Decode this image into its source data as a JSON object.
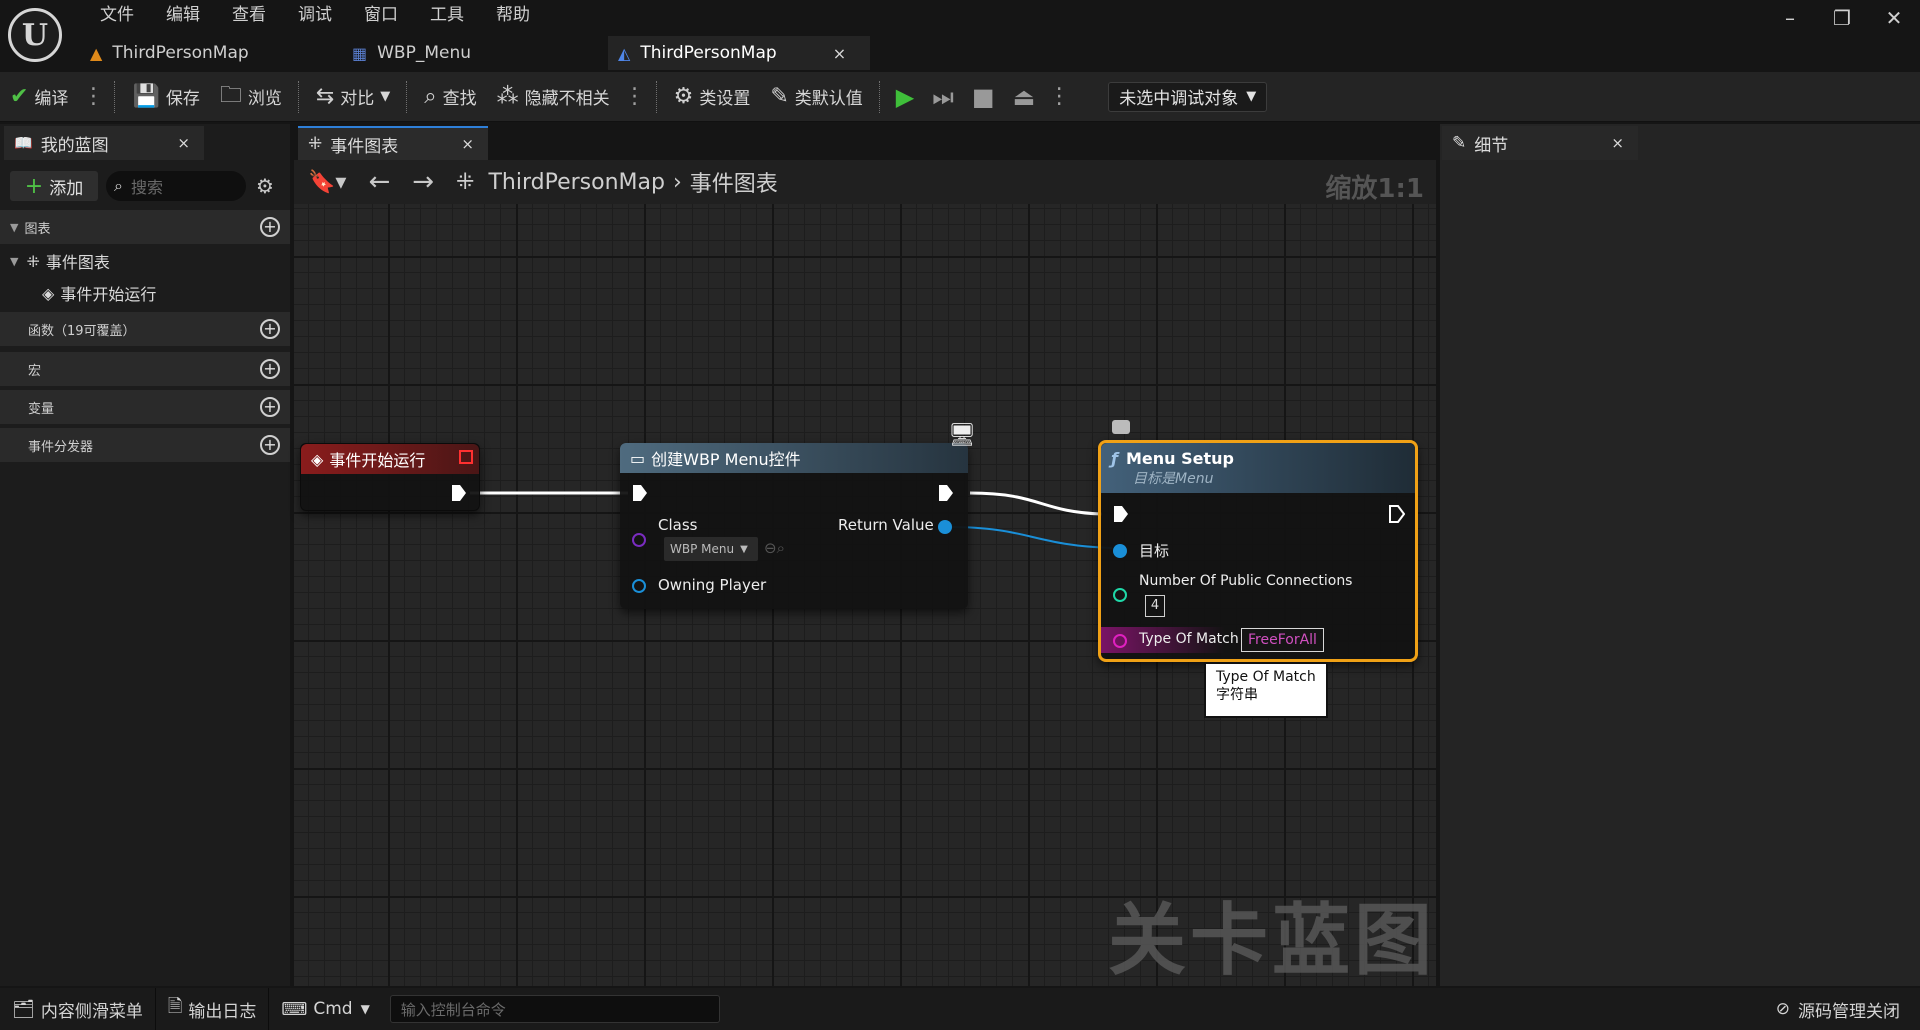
{
  "menu": [
    "文件",
    "编辑",
    "查看",
    "调试",
    "窗口",
    "工具",
    "帮助"
  ],
  "doc_tabs": [
    {
      "label": "ThirdPersonMap",
      "icon": "level-icon"
    },
    {
      "label": "WBP_Menu",
      "icon": "widget-blueprint-icon"
    },
    {
      "label": "ThirdPersonMap",
      "icon": "level-blueprint-icon",
      "active": true
    }
  ],
  "toolbar": {
    "compile": "编译",
    "save": "保存",
    "browse": "浏览",
    "diff": "对比",
    "find": "查找",
    "hide_unrelated": "隐藏不相关",
    "class_settings": "类设置",
    "class_defaults": "类默认值",
    "debug_object": "未选中调试对象"
  },
  "left_panel": {
    "tab_label": "我的蓝图",
    "add_label": "添加",
    "search_placeholder": "搜索",
    "sections": {
      "graphs": "图表",
      "event_graph": "事件图表",
      "begin_play": "事件开始运行",
      "functions": "函数（19可覆盖）",
      "macros": "宏",
      "variables": "变量",
      "dispatchers": "事件分发器"
    }
  },
  "graph": {
    "tab_label": "事件图表",
    "breadcrumb_root": "ThirdPersonMap",
    "breadcrumb_leaf": "事件图表",
    "zoom": "缩放1:1",
    "watermark": "关卡蓝图",
    "nodes": {
      "begin_play": {
        "title": "事件开始运行"
      },
      "create_widget": {
        "title": "创建WBP Menu控件",
        "class_label": "Class",
        "class_value": "WBP Menu",
        "return_label": "Return Value",
        "owning_player": "Owning Player"
      },
      "menu_setup": {
        "title": "Menu Setup",
        "subtitle": "目标是Menu",
        "target_label": "目标",
        "npc_label": "Number Of Public Connections",
        "npc_value": "4",
        "tom_label": "Type Of Match",
        "tom_value": "FreeForAll"
      }
    },
    "tooltip": {
      "line1": "Type Of Match",
      "line2": "字符串"
    }
  },
  "right_panel": {
    "tab_label": "细节"
  },
  "bottom": {
    "content_drawer": "内容侧滑菜单",
    "output_log": "输出日志",
    "cmd": "Cmd",
    "console_placeholder": "输入控制台命令",
    "source_control": "源码管理关闭"
  },
  "colors": {
    "exec_wire": "#ffffff",
    "object_wire": "#1a8fd8",
    "string_pin": "#e020c0",
    "int_pin": "#1fd8a8",
    "selection": "#f0a116",
    "play": "#3fbf3a"
  }
}
